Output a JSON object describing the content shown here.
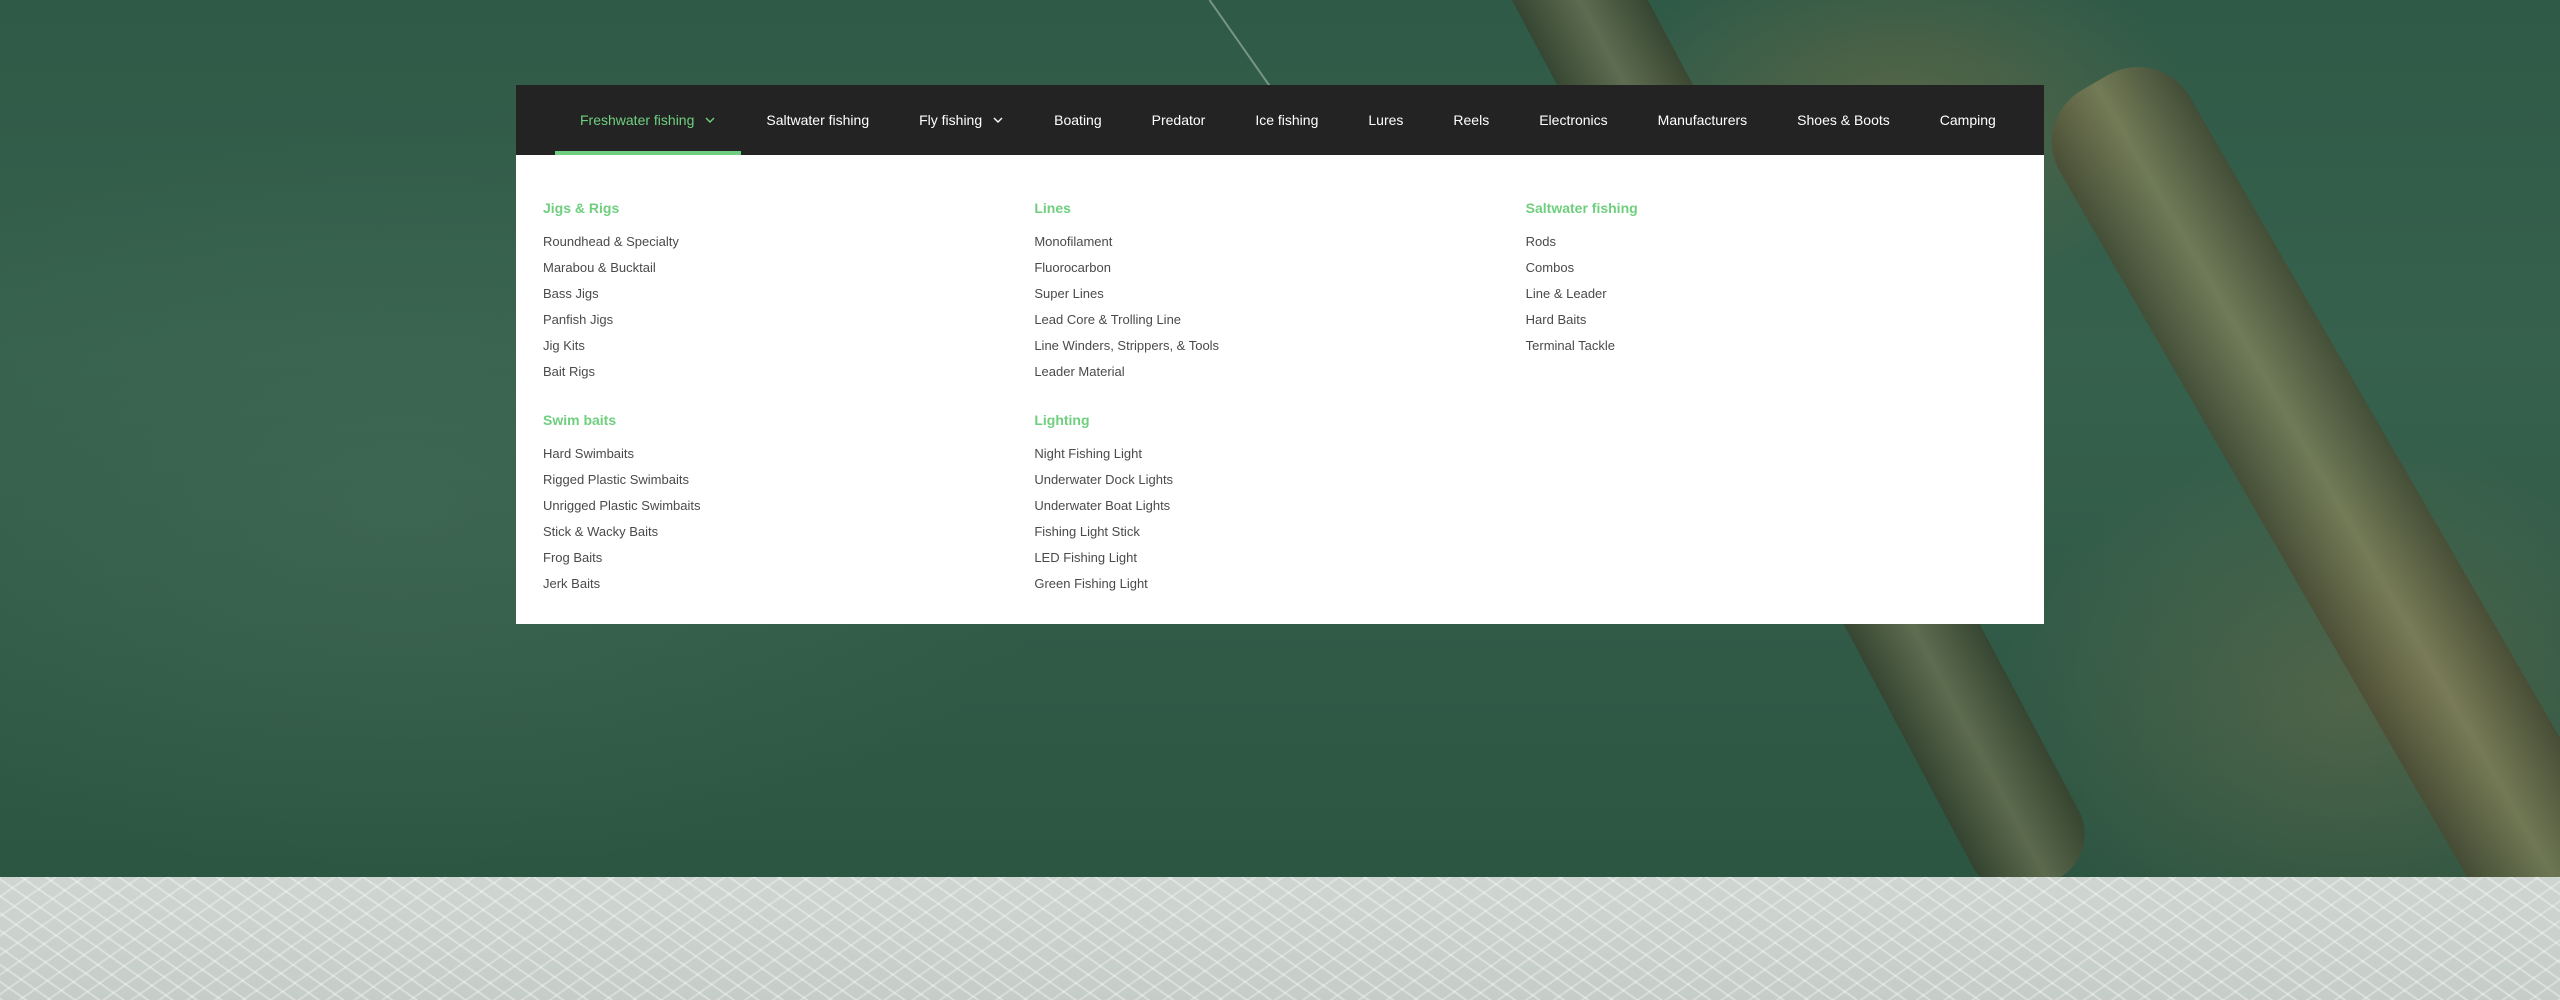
{
  "nav": {
    "items": [
      {
        "label": "Freshwater fishing",
        "active": true,
        "has_dropdown": true
      },
      {
        "label": "Saltwater fishing",
        "active": false,
        "has_dropdown": false
      },
      {
        "label": "Fly fishing",
        "active": false,
        "has_dropdown": true
      },
      {
        "label": "Boating",
        "active": false,
        "has_dropdown": false
      },
      {
        "label": "Predator",
        "active": false,
        "has_dropdown": false
      },
      {
        "label": "Ice fishing",
        "active": false,
        "has_dropdown": false
      },
      {
        "label": "Lures",
        "active": false,
        "has_dropdown": false
      },
      {
        "label": "Reels",
        "active": false,
        "has_dropdown": false
      },
      {
        "label": "Electronics",
        "active": false,
        "has_dropdown": false
      },
      {
        "label": "Manufacturers",
        "active": false,
        "has_dropdown": false
      },
      {
        "label": "Shoes & Boots",
        "active": false,
        "has_dropdown": false
      },
      {
        "label": "Camping",
        "active": false,
        "has_dropdown": false
      }
    ],
    "chevron_icon": "chevron-down-icon"
  },
  "mega_menu": {
    "columns": [
      {
        "groups": [
          {
            "title": "Jigs & Rigs",
            "items": [
              "Roundhead & Specialty",
              "Marabou & Bucktail",
              "Bass Jigs",
              "Panfish Jigs",
              "Jig Kits",
              "Bait Rigs"
            ]
          },
          {
            "title": "Swim baits",
            "items": [
              "Hard Swimbaits",
              "Rigged Plastic Swimbaits",
              "Unrigged Plastic Swimbaits",
              "Stick & Wacky Baits",
              "Frog Baits",
              "Jerk Baits"
            ]
          }
        ]
      },
      {
        "groups": [
          {
            "title": "Lines",
            "items": [
              "Monofilament",
              "Fluorocarbon",
              "Super Lines",
              "Lead Core & Trolling Line",
              "Line Winders, Strippers, & Tools",
              "Leader Material"
            ]
          },
          {
            "title": "Lighting",
            "items": [
              "Night Fishing Light",
              "Underwater Dock Lights",
              "Underwater Boat Lights",
              "Fishing Light Stick",
              "LED Fishing Light",
              "Green Fishing Light"
            ]
          }
        ]
      },
      {
        "groups": [
          {
            "title": "Saltwater fishing",
            "items": [
              "Rods",
              "Combos",
              "Line & Leader",
              "Hard Baits",
              "Terminal Tackle"
            ]
          }
        ]
      }
    ]
  },
  "colors": {
    "accent": "#6fcf7f",
    "nav_background": "#232323",
    "menu_text": "#4a4a4a"
  }
}
